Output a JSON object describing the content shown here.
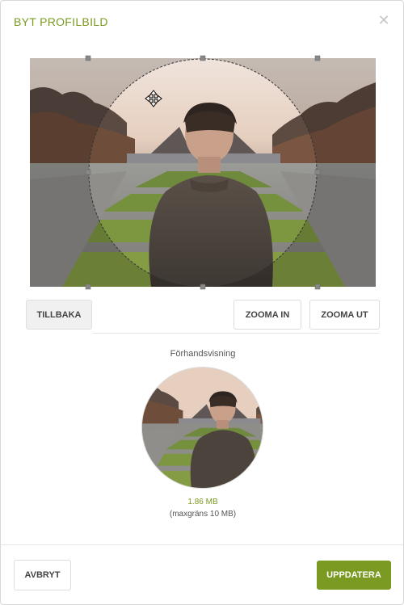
{
  "dialog": {
    "title": "BYT PROFILBILD",
    "close_icon": "close-icon"
  },
  "cropper": {
    "move_cursor_icon": "move-cursor-icon"
  },
  "toolbar": {
    "back_label": "TILLBAKA",
    "zoom_in_label": "ZOOMA IN",
    "zoom_out_label": "ZOOMA UT"
  },
  "preview": {
    "label": "Förhandsvisning",
    "file_size": "1.86 MB",
    "max_size_note": "(maxgräns 10 MB)"
  },
  "footer": {
    "cancel_label": "AVBRYT",
    "update_label": "UPPDATERA"
  },
  "colors": {
    "accent": "#7a9a22"
  }
}
